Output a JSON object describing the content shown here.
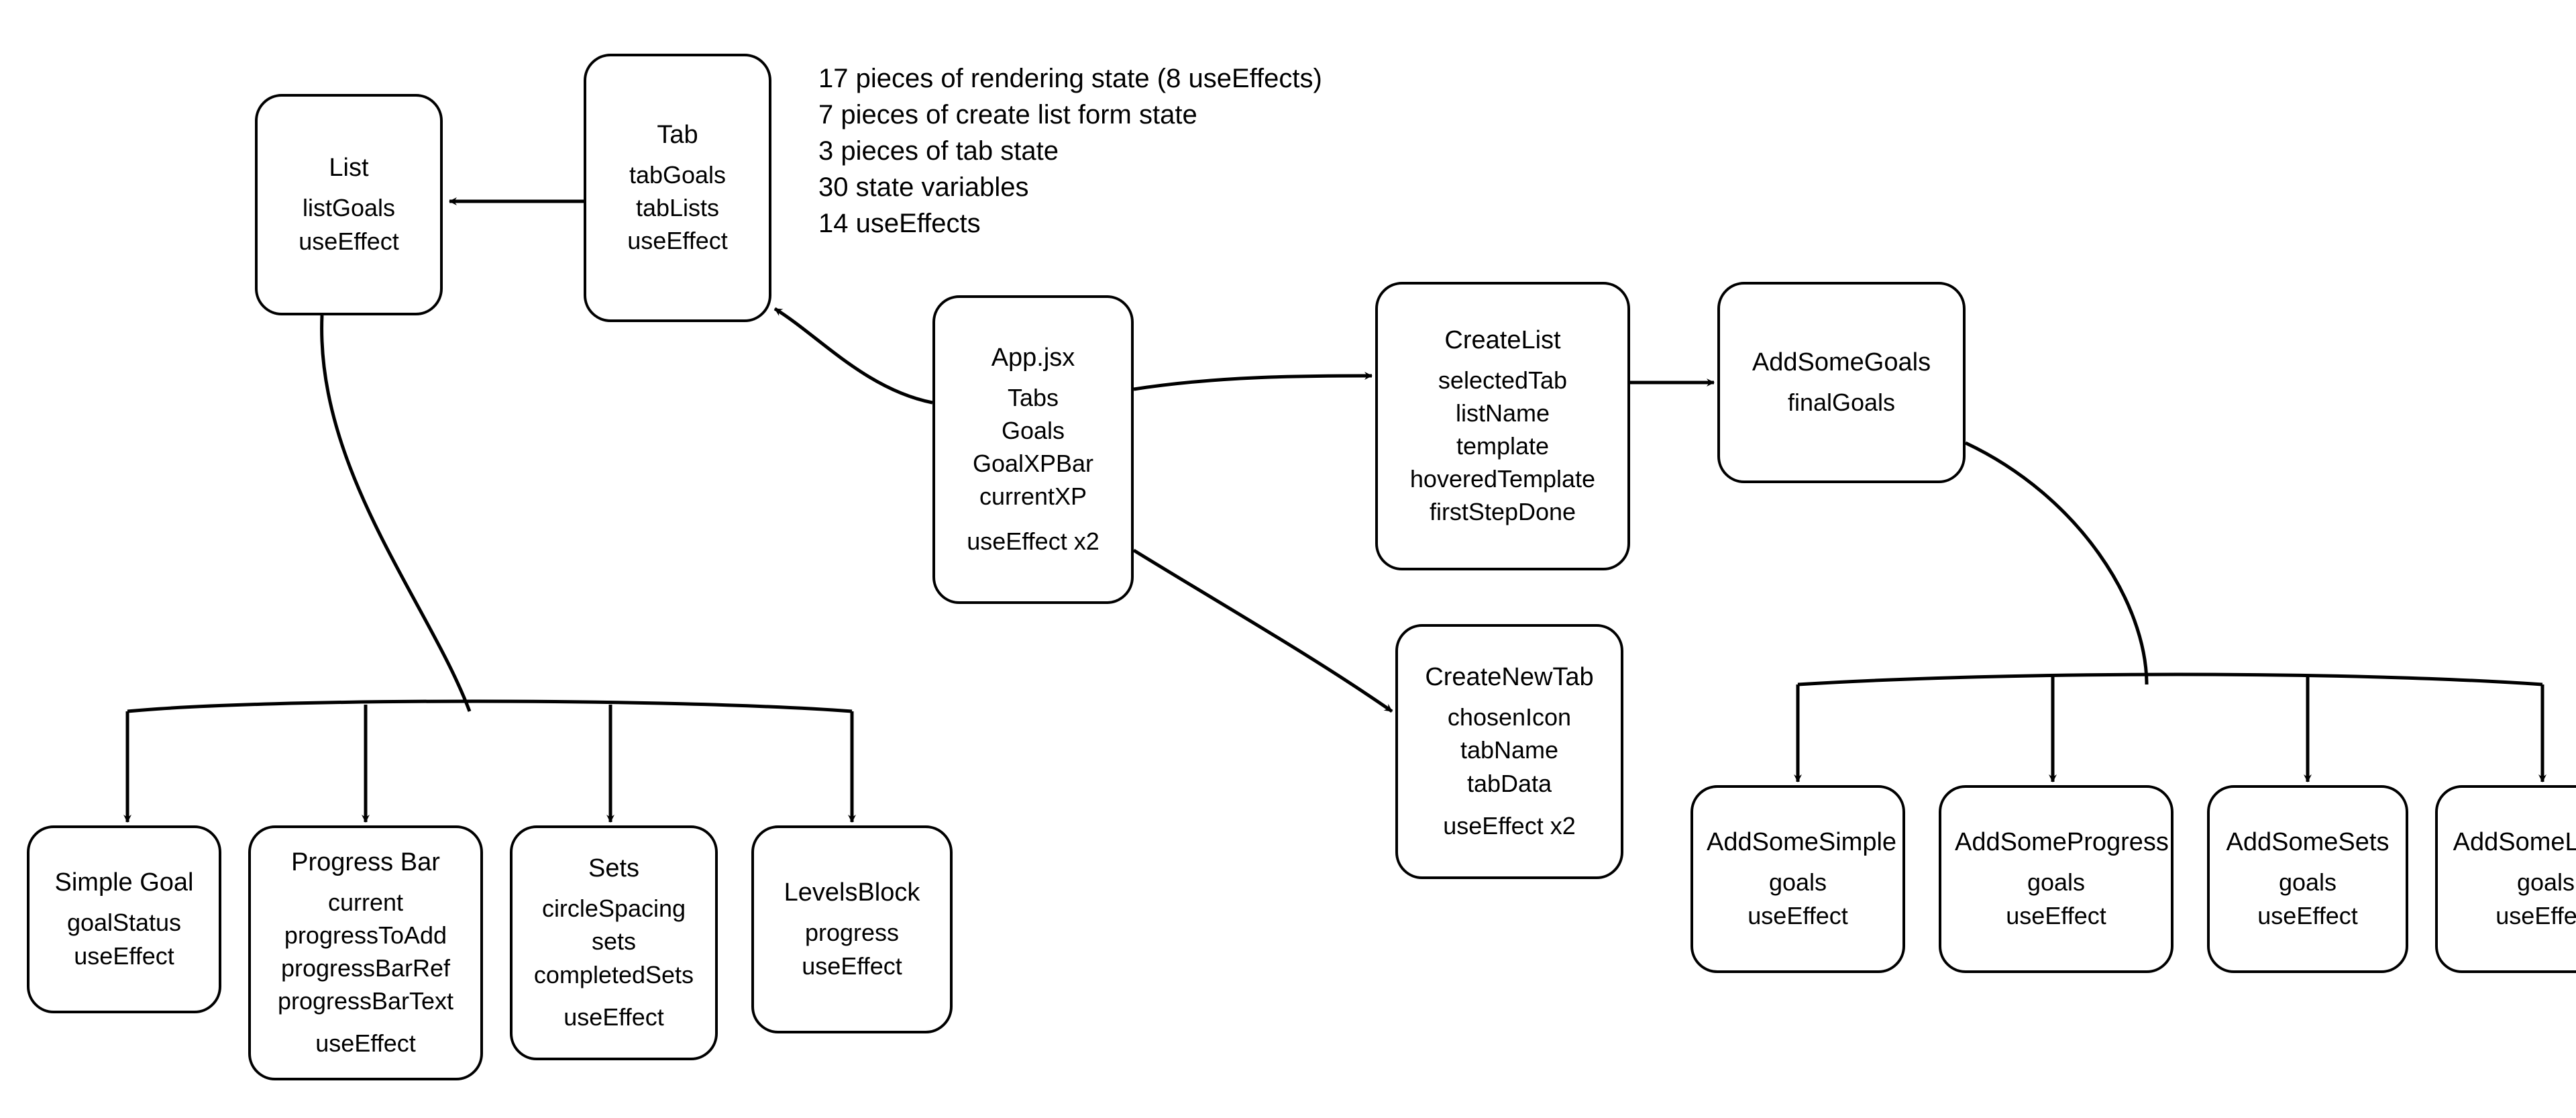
{
  "notes": {
    "l1": "17 pieces of rendering state (8 useEffects)",
    "l2": "7 pieces of create list form state",
    "l3": "3 pieces of tab state",
    "l4": "30 state variables",
    "l5": "14 useEffects"
  },
  "nodes": {
    "list": {
      "title": "List",
      "lines": [
        "listGoals",
        "useEffect"
      ]
    },
    "tab": {
      "title": "Tab",
      "lines": [
        "tabGoals",
        "tabLists",
        "useEffect"
      ]
    },
    "app": {
      "title": "App.jsx",
      "lines": [
        "Tabs",
        "Goals",
        "GoalXPBar",
        "currentXP",
        "useEffect x2"
      ]
    },
    "createList": {
      "title": "CreateList",
      "lines": [
        "selectedTab",
        "listName",
        "template",
        "hoveredTemplate",
        "firstStepDone"
      ]
    },
    "addSomeGoals": {
      "title": "AddSomeGoals",
      "lines": [
        "finalGoals"
      ]
    },
    "createNewTab": {
      "title": "CreateNewTab",
      "lines": [
        "chosenIcon",
        "tabName",
        "tabData",
        "useEffect x2"
      ]
    },
    "simpleGoal": {
      "title": "Simple Goal",
      "lines": [
        "goalStatus",
        "useEffect"
      ]
    },
    "progressBar": {
      "title": "Progress Bar",
      "lines": [
        "current",
        "progressToAdd",
        "progressBarRef",
        "progressBarText",
        "useEffect"
      ]
    },
    "sets": {
      "title": "Sets",
      "lines": [
        "circleSpacing",
        "sets",
        "completedSets",
        "useEffect"
      ]
    },
    "levelsBlock": {
      "title": "LevelsBlock",
      "lines": [
        "progress",
        "useEffect"
      ]
    },
    "addSomeSimple": {
      "title": "AddSomeSimple",
      "lines": [
        "goals",
        "useEffect"
      ]
    },
    "addSomeProgress": {
      "title": "AddSomeProgress",
      "lines": [
        "goals",
        "useEffect"
      ]
    },
    "addSomeSets": {
      "title": "AddSomeSets",
      "lines": [
        "goals",
        "useEffect"
      ]
    },
    "addSomeLevels": {
      "title": "AddSomeLevels",
      "lines": [
        "goals",
        "useEffect"
      ]
    }
  },
  "chart_data": {
    "type": "diagram",
    "description": "React component tree showing state variables and useEffect hooks",
    "edges": [
      {
        "from": "Tab",
        "to": "List"
      },
      {
        "from": "App.jsx",
        "to": "Tab"
      },
      {
        "from": "App.jsx",
        "to": "CreateList"
      },
      {
        "from": "App.jsx",
        "to": "CreateNewTab"
      },
      {
        "from": "CreateList",
        "to": "AddSomeGoals"
      },
      {
        "from": "List",
        "to": "Simple Goal"
      },
      {
        "from": "List",
        "to": "Progress Bar"
      },
      {
        "from": "List",
        "to": "Sets"
      },
      {
        "from": "List",
        "to": "LevelsBlock"
      },
      {
        "from": "AddSomeGoals",
        "to": "AddSomeSimple"
      },
      {
        "from": "AddSomeGoals",
        "to": "AddSomeProgress"
      },
      {
        "from": "AddSomeGoals",
        "to": "AddSomeSets"
      },
      {
        "from": "AddSomeGoals",
        "to": "AddSomeLevels"
      }
    ],
    "summary_counts": {
      "rendering_state_pieces": 17,
      "rendering_useEffects": 8,
      "create_list_form_state_pieces": 7,
      "tab_state_pieces": 3,
      "total_state_variables": 30,
      "total_useEffects": 14
    }
  }
}
